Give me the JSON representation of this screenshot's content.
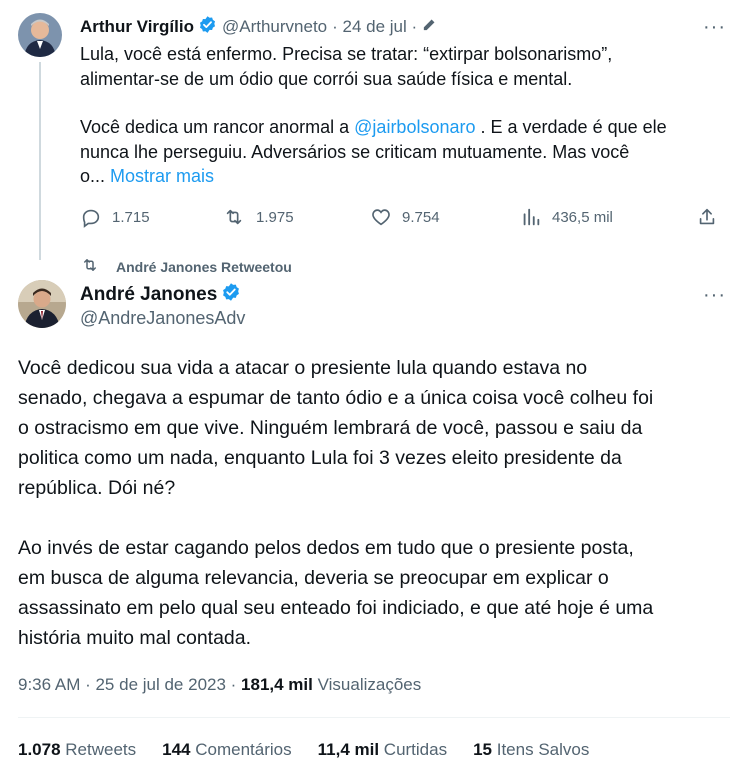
{
  "tweet1": {
    "display_name": "Arthur Virgílio",
    "handle": "@Arthurvneto",
    "date": "· 24 de jul ·",
    "line1": "Lula, você  está enfermo. Precisa se tratar: “extirpar bolsonarismo”,",
    "line2": "alimentar-se de um ódio que corrói sua saúde física e mental.",
    "line3_pre": "Você dedica um rancor anormal a ",
    "mention": "@jairbolsonaro",
    "line3_post": " . E a verdade é que ele",
    "line4": "nunca lhe perseguiu. Adversários se criticam mutuamente. Mas você",
    "line5_pre": "o... ",
    "show_more": "Mostrar mais",
    "replies": "1.715",
    "retweets": "1.975",
    "likes": "9.754",
    "views": "436,5 mil"
  },
  "retweet_banner": "André Janones Retweetou",
  "tweet2": {
    "display_name": "André Janones",
    "handle": "@AndreJanonesAdv",
    "p1": [
      "Você dedicou sua vida a atacar o presiente lula quando estava no",
      "senado, chegava a espumar de tanto ódio e a única coisa você colheu foi",
      "o ostracismo em que vive. Ninguém lembrará de você, passou  e saiu da",
      "politica como um nada, enquanto Lula foi 3 vezes eleito presidente da",
      "república. Dói né?"
    ],
    "p2": [
      "Ao invés de estar cagando pelos dedos em tudo que o presiente posta,",
      "em busca de alguma relevancia, deveria se preocupar em explicar o",
      "assassinato em pelo qual seu enteado foi indiciado, e que até hoje é uma",
      "história muito mal contada."
    ],
    "time_date": "9:36 AM · 25 de jul de 2023 · ",
    "views_count": "181,4 mil",
    "views_label": " Visualizações",
    "stats": {
      "retweets_count": "1.078",
      "retweets_label": " Retweets",
      "comments_count": "144",
      "comments_label": " Comentários",
      "likes_count": "11,4 mil",
      "likes_label": " Curtidas",
      "saved_count": "15",
      "saved_label": " Itens Salvos"
    }
  },
  "icons": {
    "verified": "verified-badge-icon",
    "edit": "edit-pencil-icon",
    "more": "more-dots-icon",
    "reply": "reply-icon",
    "retweet": "retweet-icon",
    "like": "like-icon",
    "views": "views-icon",
    "share": "share-icon"
  },
  "more_glyph": "···",
  "colors": {
    "accent": "#1d9bf0",
    "text": "#0f1419",
    "muted": "#536471",
    "thread_line": "#cfd9de"
  }
}
